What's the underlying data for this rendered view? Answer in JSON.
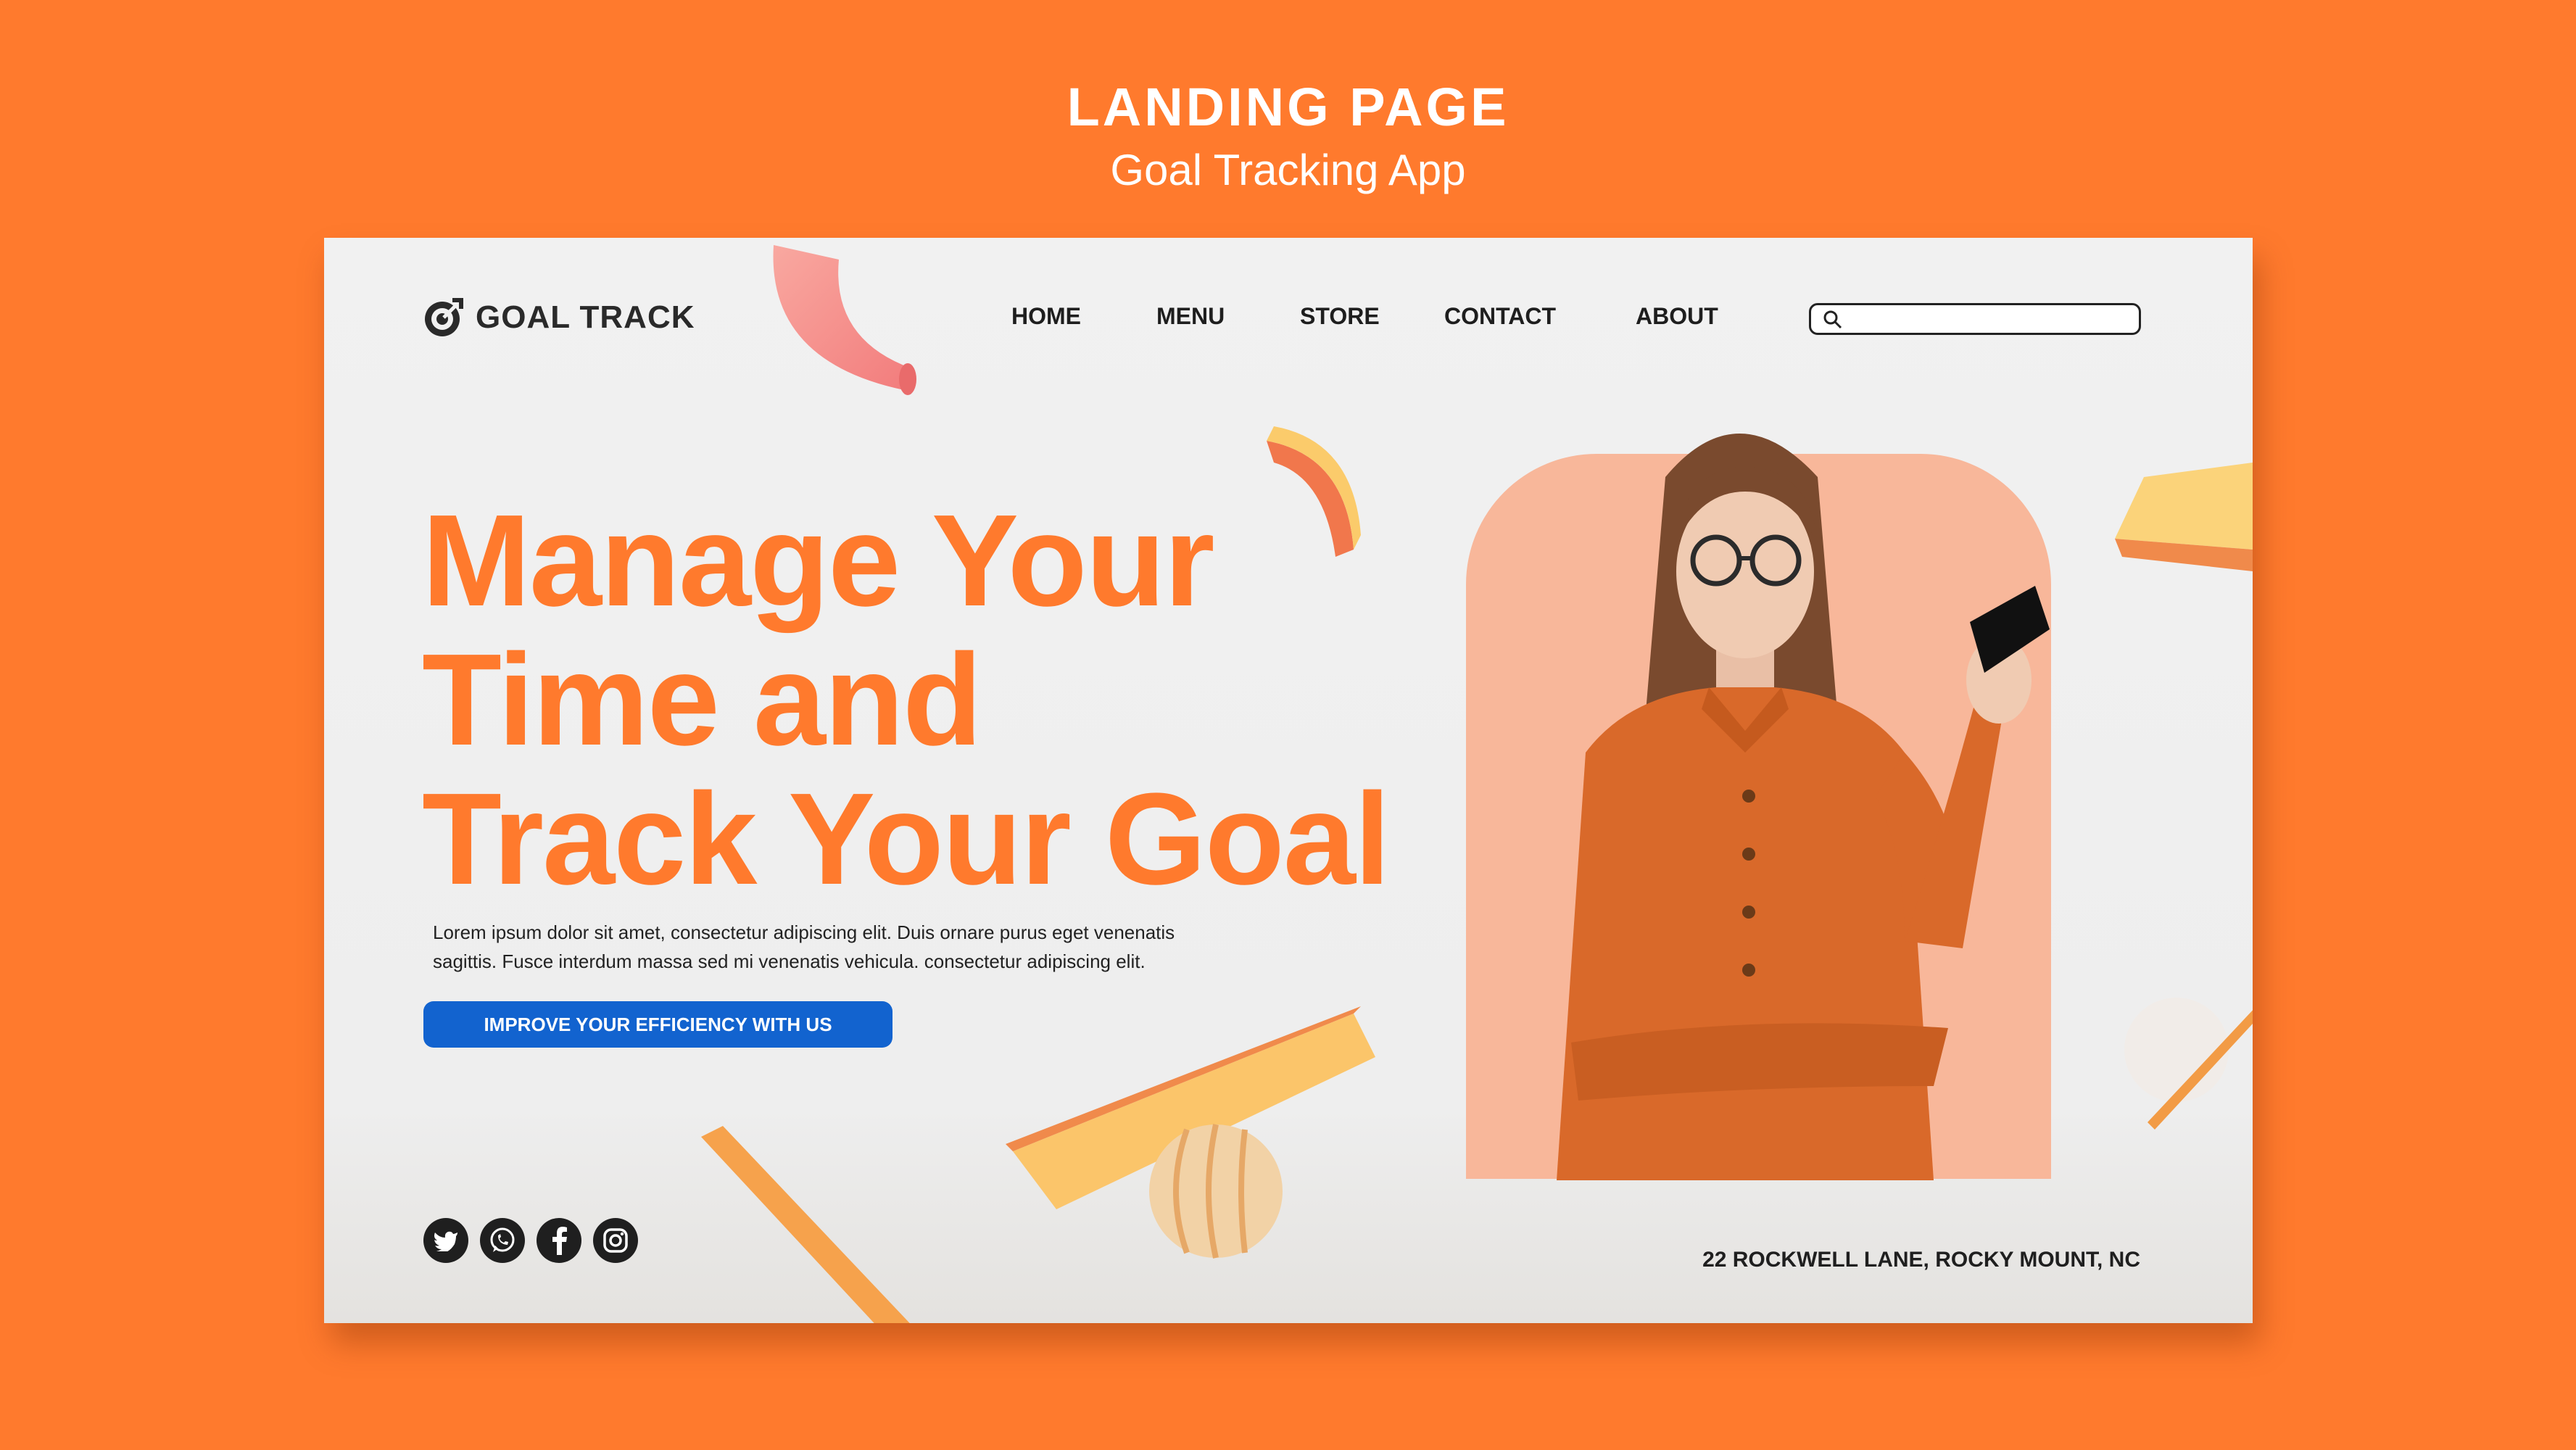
{
  "banner": {
    "title": "LANDING PAGE",
    "subtitle": "Goal Tracking App"
  },
  "header": {
    "logo_text": "GOAL TRACK",
    "logo_icon": "target-icon",
    "nav": [
      {
        "label": "HOME"
      },
      {
        "label": "MENU"
      },
      {
        "label": "STORE"
      },
      {
        "label": "CONTACT"
      },
      {
        "label": "ABOUT"
      }
    ],
    "search": {
      "placeholder": "",
      "value": "",
      "icon": "search-icon"
    }
  },
  "hero": {
    "headline_lines": [
      "Manage Your",
      "Time and",
      "Track Your Goal"
    ],
    "body_line1": "Lorem ipsum dolor sit amet, consectetur adipiscing elit. Duis ornare purus eget venenatis",
    "body_line2": "sagittis. Fusce interdum massa sed mi venenatis vehicula. consectetur adipiscing elit.",
    "cta_label": "IMPROVE YOUR EFFICIENCY WITH US"
  },
  "footer": {
    "socials": [
      {
        "icon": "twitter-icon"
      },
      {
        "icon": "whatsapp-icon"
      },
      {
        "icon": "facebook-icon"
      },
      {
        "icon": "instagram-icon"
      }
    ],
    "address": "22 ROCKWELL LANE, ROCKY MOUNT, NC"
  },
  "colors": {
    "background": "#FF7A2D",
    "accent": "#FF7A2D",
    "button": "#1263CF",
    "card": "#EFEFEF",
    "photo_backdrop": "#F8B79A",
    "dark": "#1F1F1F"
  }
}
